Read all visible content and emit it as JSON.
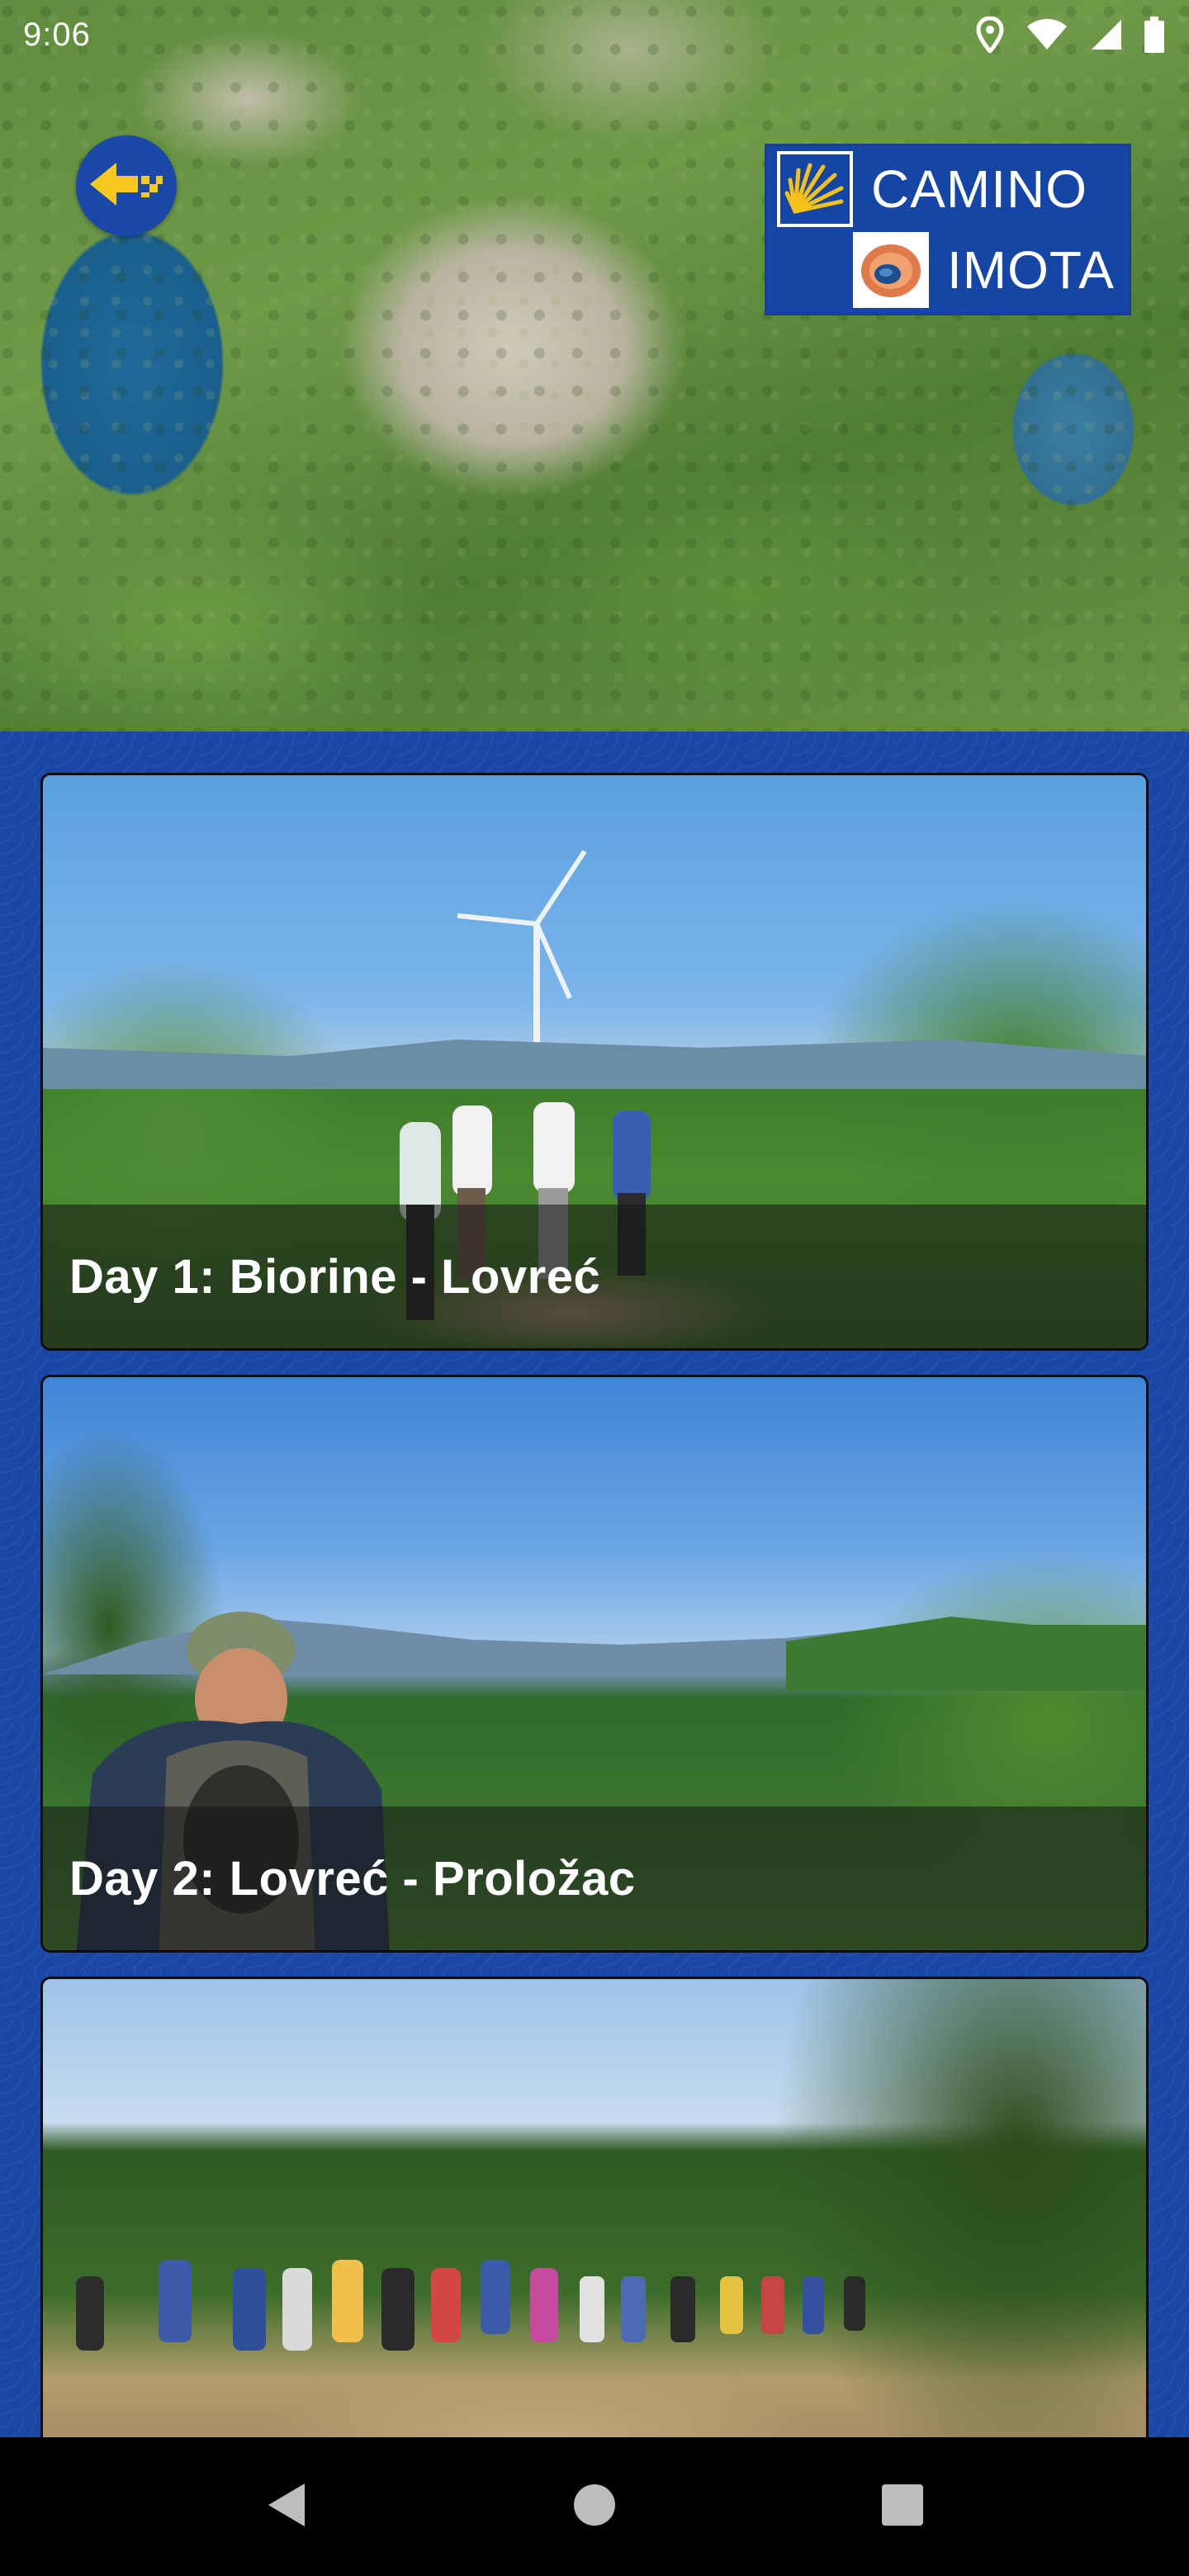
{
  "status_bar": {
    "time": "9:06",
    "icons": [
      "location-icon",
      "wifi-icon",
      "signal-icon",
      "battery-icon"
    ]
  },
  "header": {
    "back_icon": "arrow-left-icon",
    "logo": {
      "line1": "CAMINO",
      "line2": "IMOTA",
      "brand_color": "#1546a6",
      "shell_color": "#f4c11a"
    }
  },
  "routes": [
    {
      "title": "Day 1: Biorine - Lovreć"
    },
    {
      "title": "Day 2: Lovreć - Proložac"
    },
    {
      "title": ""
    }
  ],
  "nav": {
    "icons": [
      "back-triangle-icon",
      "home-circle-icon",
      "recents-square-icon"
    ]
  },
  "colors": {
    "accent": "#1a46a5",
    "caption_overlay": "rgba(20,20,20,0.55)"
  }
}
